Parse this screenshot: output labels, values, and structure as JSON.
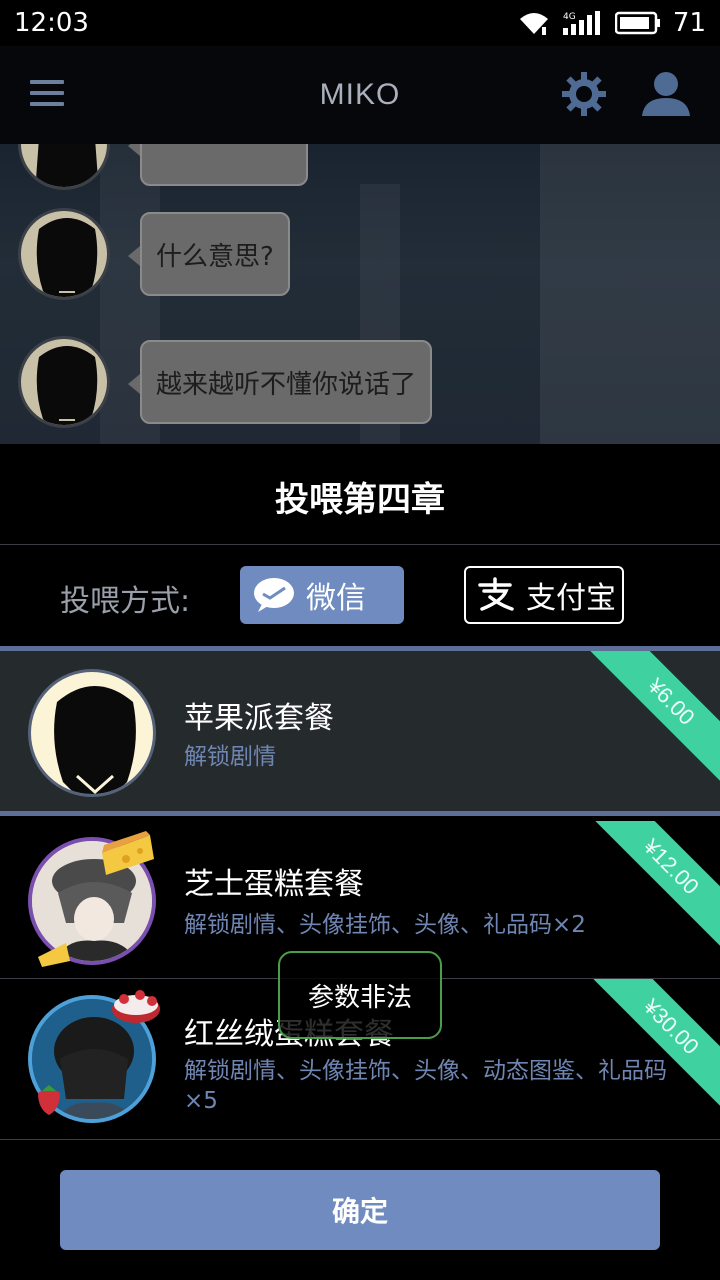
{
  "status_bar": {
    "time": "12:03",
    "network": "4G",
    "battery": "71"
  },
  "header": {
    "title": "MIKO"
  },
  "chat": {
    "messages": [
      {
        "text": ""
      },
      {
        "text": "什么意思?"
      },
      {
        "text": "越来越听不懂你说话了"
      }
    ]
  },
  "sheet": {
    "title": "投喂第四章",
    "payment_label": "投喂方式:",
    "payment_methods": [
      {
        "label": "微信",
        "selected": true
      },
      {
        "label": "支付宝",
        "selected": false
      }
    ],
    "packages": [
      {
        "name": "苹果派套餐",
        "desc": "解锁剧情",
        "price": "¥6.00",
        "selected": true
      },
      {
        "name": "芝士蛋糕套餐",
        "desc": "解锁剧情、头像挂饰、头像、礼品码×2",
        "price": "¥12.00",
        "selected": false
      },
      {
        "name": "红丝绒蛋糕套餐",
        "desc": "解锁剧情、头像挂饰、头像、动态图鉴、礼品码×5",
        "price": "¥30.00",
        "selected": false
      }
    ],
    "toast": "参数非法",
    "confirm_label": "确定"
  },
  "colors": {
    "accent": "#6f8bc0",
    "price_tag": "#3fd1a0",
    "selected_bg": "#252a2d",
    "desc_text": "#6f86b3"
  }
}
